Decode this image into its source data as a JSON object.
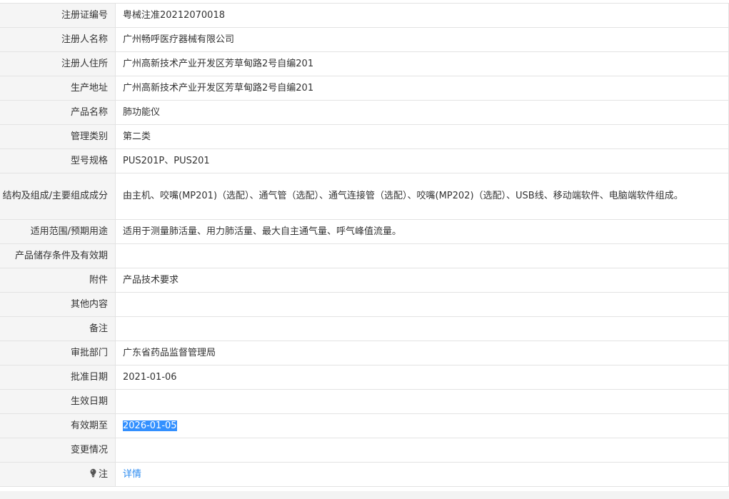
{
  "rows": [
    {
      "label": "注册证编号",
      "value": "粤械注准20212070018"
    },
    {
      "label": "注册人名称",
      "value": "广州畅呼医疗器械有限公司"
    },
    {
      "label": "注册人住所",
      "value": "广州高新技术产业开发区芳草甸路2号自编201"
    },
    {
      "label": "生产地址",
      "value": "广州高新技术产业开发区芳草甸路2号自编201"
    },
    {
      "label": "产品名称",
      "value": "肺功能仪"
    },
    {
      "label": "管理类别",
      "value": "第二类"
    },
    {
      "label": "型号规格",
      "value": "PUS201P、PUS201"
    },
    {
      "label": "结构及组成/主要组成成分",
      "value": "由主机、咬嘴(MP201)（选配）、通气管（选配）、通气连接管（选配）、咬嘴(MP202)（选配）、USB线、移动端软件、电脑端软件组成。"
    },
    {
      "label": "适用范围/预期用途",
      "value": "适用于测量肺活量、用力肺活量、最大自主通气量、呼气峰值流量。"
    },
    {
      "label": "产品储存条件及有效期",
      "value": ""
    },
    {
      "label": "附件",
      "value": "产品技术要求"
    },
    {
      "label": "其他内容",
      "value": ""
    },
    {
      "label": "备注",
      "value": ""
    },
    {
      "label": "审批部门",
      "value": "广东省药品监督管理局"
    },
    {
      "label": "批准日期",
      "value": "2021-01-06"
    },
    {
      "label": "生效日期",
      "value": ""
    },
    {
      "label": "有效期至",
      "value": "2026-01-05"
    },
    {
      "label": "变更情况",
      "value": ""
    },
    {
      "label": "注",
      "value": "详情"
    }
  ],
  "icons": {
    "note": "lightbulb-icon"
  },
  "colors": {
    "link": "#2d8cf0",
    "selection": "#3390ff",
    "label_bg": "#f5f5f5",
    "border": "#e3e3e3"
  }
}
